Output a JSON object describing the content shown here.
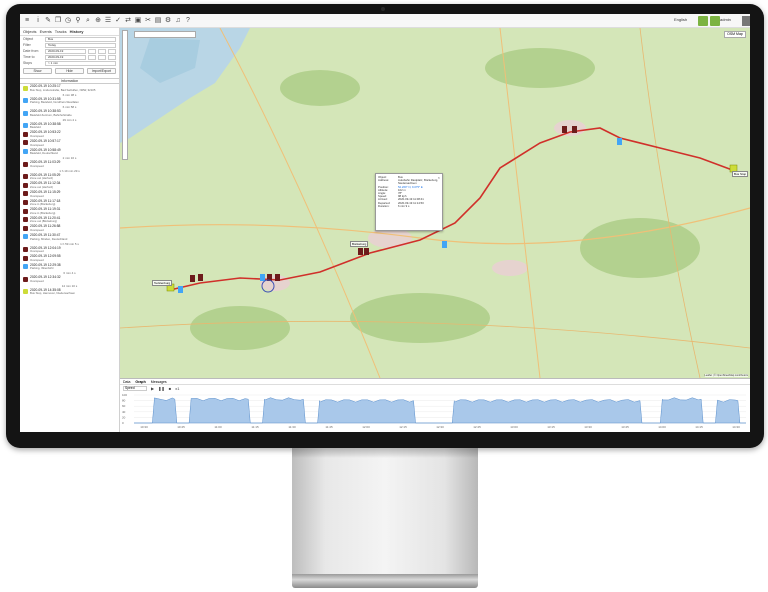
{
  "sidebar": {
    "tabs": [
      "Objects",
      "Events",
      "Tracks",
      "History"
    ],
    "filters": [
      {
        "label": "Object",
        "value": "Bus"
      },
      {
        "label": "Filter",
        "value": "Today"
      },
      {
        "label": "Date from",
        "value": "2020-09-19"
      },
      {
        "label": "Time to",
        "value": "2020-09-19"
      },
      {
        "label": "Stops",
        "value": "> 1 min"
      }
    ],
    "buttons": [
      "Show",
      "Hide",
      "Import/Export"
    ],
    "info_header": "Information",
    "events": [
      {
        "time": "2020-09-19 10:25:17",
        "addr": "Bus Stop, Lindenstraße, Bad Salzuflen, NRW, 32105",
        "color": "#cddc39"
      },
      {
        "time": "",
        "addr": "",
        "dur": "6 min 38 s",
        "color": ""
      },
      {
        "time": "2020-09-19 10:31:55",
        "addr": "Parking, Bielefeld, Nordrhein-Westfalen",
        "color": "#42a5f5"
      },
      {
        "time": "",
        "addr": "",
        "dur": "6 min 58 s",
        "color": ""
      },
      {
        "time": "2020-09-19 10:38:53",
        "addr": "Bielefeld Zentrum, Bahnhofstraße",
        "color": "#42a5f5"
      },
      {
        "time": "",
        "addr": "",
        "dur": "29 min 4 s",
        "color": ""
      },
      {
        "time": "2020-09-19 10:38:58",
        "addr": "Bielefeld",
        "color": "#42a5f5"
      },
      {
        "time": "",
        "addr": "",
        "dur": "",
        "color": ""
      },
      {
        "time": "2020-09-19 10:53:22",
        "addr": "Overspeed",
        "color": "#6d1b1b"
      },
      {
        "time": "2020-09-19 10:57:17",
        "addr": "Overspeed",
        "color": "#6d1b1b"
      },
      {
        "time": "2020-09-19 10:58:49",
        "addr": "Bielefeld, Deutschland",
        "color": "#42a5f5"
      },
      {
        "time": "",
        "addr": "",
        "dur": "2 min 16 s",
        "color": ""
      },
      {
        "time": "2020-09-19 11:03:29",
        "addr": "Overspeed",
        "color": "#6d1b1b"
      },
      {
        "time": "",
        "addr": "",
        "dur": "1 h 19 min 29 s",
        "color": ""
      },
      {
        "time": "2020-09-19 11:05:29",
        "addr": "Zone out (Herford)",
        "color": "#6d1b1b"
      },
      {
        "time": "2020-09-19 11:12:34",
        "addr": "Zone out (Herford)",
        "color": "#6d1b1b"
      },
      {
        "time": "2020-09-19 11:15:29",
        "addr": "Overspeed",
        "color": "#6d1b1b"
      },
      {
        "time": "2020-09-19 11:17:18",
        "addr": "Zone in (Bückeburg)",
        "color": "#6d1b1b"
      },
      {
        "time": "2020-09-19 11:19:31",
        "addr": "Zone in (Bückeburg)",
        "color": "#6d1b1b"
      },
      {
        "time": "2020-09-19 11:20:41",
        "addr": "Zone out (Bückeburg)",
        "color": "#6d1b1b"
      },
      {
        "time": "2020-09-19 11:26:58",
        "addr": "Overspeed",
        "color": "#6d1b1b"
      },
      {
        "time": "2020-09-19 11:30:47",
        "addr": "Parking, Minden, Deutschland",
        "color": "#42a5f5"
      },
      {
        "time": "",
        "addr": "",
        "dur": "1 h 59 min 5 s",
        "color": ""
      },
      {
        "time": "2020-09-19 12:04:19",
        "addr": "Overspeed",
        "color": "#6d1b1b"
      },
      {
        "time": "2020-09-19 12:09:55",
        "addr": "Overspeed",
        "color": "#6d1b1b"
      },
      {
        "time": "2020-09-19 12:29:38",
        "addr": "Parking, Ibbenbühl",
        "color": "#42a5f5"
      },
      {
        "time": "",
        "addr": "",
        "dur": "6 min 4 s",
        "color": ""
      },
      {
        "time": "2020-09-19 12:34:32",
        "addr": "Overspeed",
        "color": "#6d1b1b"
      },
      {
        "time": "",
        "addr": "",
        "dur": "14 min 10 s",
        "color": ""
      },
      {
        "time": "2020-09-19 14:35:08",
        "addr": "Bus Stop, Hannover, Niedersachsen",
        "color": "#cddc39"
      }
    ]
  },
  "topbar": {
    "language": "English",
    "user": "admin"
  },
  "map": {
    "layer": "OSM Map",
    "cities": [
      {
        "name": "Bus Stop",
        "x": 612,
        "y": 143
      },
      {
        "name": "Bückeburg",
        "x": 230,
        "y": 213
      },
      {
        "name": "Tecklenburg",
        "x": 32,
        "y": 252
      }
    ],
    "popup": [
      {
        "k": "Object:",
        "v": "Bus",
        "link": false
      },
      {
        "k": "Address:",
        "v": "Autobahn Rastplatz, Bückeburg, Niedersachsen",
        "link": false
      },
      {
        "k": "Position:",
        "v": "52.260° N, 9.075° E",
        "link": true
      },
      {
        "k": "Altitude:",
        "v": "102 m",
        "link": false
      },
      {
        "k": "Angle:",
        "v": "78°",
        "link": false
      },
      {
        "k": "Speed:",
        "v": "98 kph",
        "link": false
      },
      {
        "k": "Arrived:",
        "v": "2020-09-19 11:08:41",
        "link": false
      },
      {
        "k": "Departed:",
        "v": "2020-09-19 11:14:50",
        "link": false
      },
      {
        "k": "Duration:",
        "v": "6 min 9 s",
        "link": false
      }
    ],
    "attribution": "Leaflet | © OpenStreetMap contributors"
  },
  "bottom": {
    "tabs": [
      "Data",
      "Graph",
      "Messages"
    ],
    "select": "Speed",
    "graph_label": "kph",
    "y_ticks": [
      "100",
      "80",
      "60",
      "40",
      "20",
      "0"
    ],
    "x_ticks": [
      "10:30",
      "10:45",
      "11:00",
      "11:15",
      "11:30",
      "11:45",
      "12:00",
      "12:15",
      "12:30",
      "12:45",
      "13:00",
      "13:15",
      "13:30",
      "13:45",
      "14:00",
      "14:15",
      "14:30"
    ]
  }
}
